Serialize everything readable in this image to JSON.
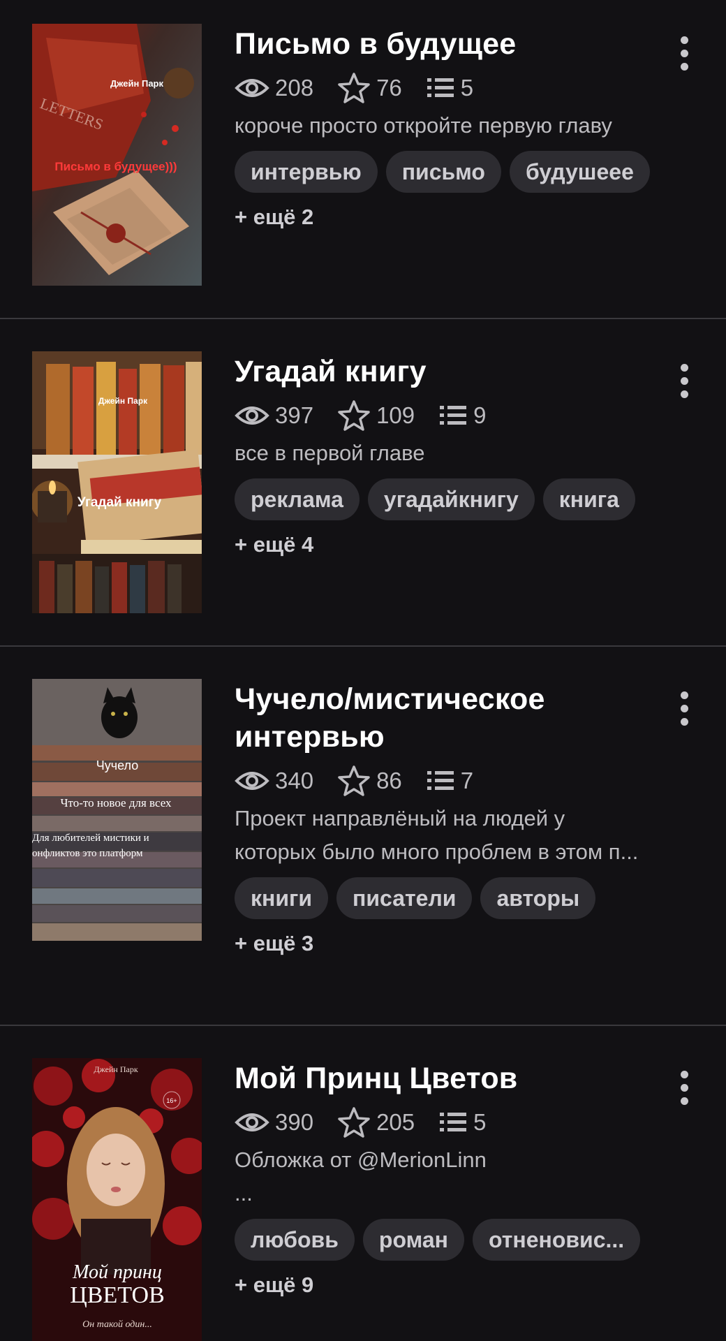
{
  "colors": {
    "background": "#121114",
    "divider": "#3a393d",
    "tag_bg": "#2d2c31",
    "muted_text": "#bdbcc0"
  },
  "stories": [
    {
      "title": "Письмо в будущее",
      "views": "208",
      "stars": "76",
      "chapters": "5",
      "description": [
        "короче просто откройте первую главу"
      ],
      "tags": [
        "интервью",
        "письмо",
        "будушеее"
      ],
      "more_tags": "+ ещё 2",
      "cover": {
        "author": "Джейн Парк",
        "text": "Письмо в будущее)))",
        "extra": "LETTERS"
      }
    },
    {
      "title": "Угадай книгу",
      "views": "397",
      "stars": "109",
      "chapters": "9",
      "description": [
        "все в первой главе"
      ],
      "tags": [
        "реклама",
        "угадайкнигу",
        "книга"
      ],
      "more_tags": "+ ещё 4",
      "cover": {
        "author": "Джейн Парк",
        "text": "Угадай книгу"
      }
    },
    {
      "title_lines": [
        "Чучело/мистическое",
        "интервью"
      ],
      "views": "340",
      "stars": "86",
      "chapters": "7",
      "description": [
        "Проект направлёный на людей у",
        "которых было много проблем в этом п..."
      ],
      "tags": [
        "книги",
        "писатели",
        "авторы"
      ],
      "more_tags": "+ ещё 3",
      "cover": {
        "line1": "Чучело",
        "line2": "Что-то новое для всех",
        "line3": "Для любителей мистики и",
        "line4": "онфликтов это платформ"
      }
    },
    {
      "title": "Мой Принц Цветов",
      "views": "390",
      "stars": "205",
      "chapters": "5",
      "description": [
        "Обложка от @MerionLinn",
        "..."
      ],
      "tags": [
        "любовь",
        "роман",
        "отненовис..."
      ],
      "more_tags": "+ ещё 9",
      "cover": {
        "author": "Джейн Парк",
        "script": "Мой принц",
        "big": "ЦВЕТОВ",
        "sub": "Он такой один...",
        "age": "16+"
      }
    }
  ]
}
